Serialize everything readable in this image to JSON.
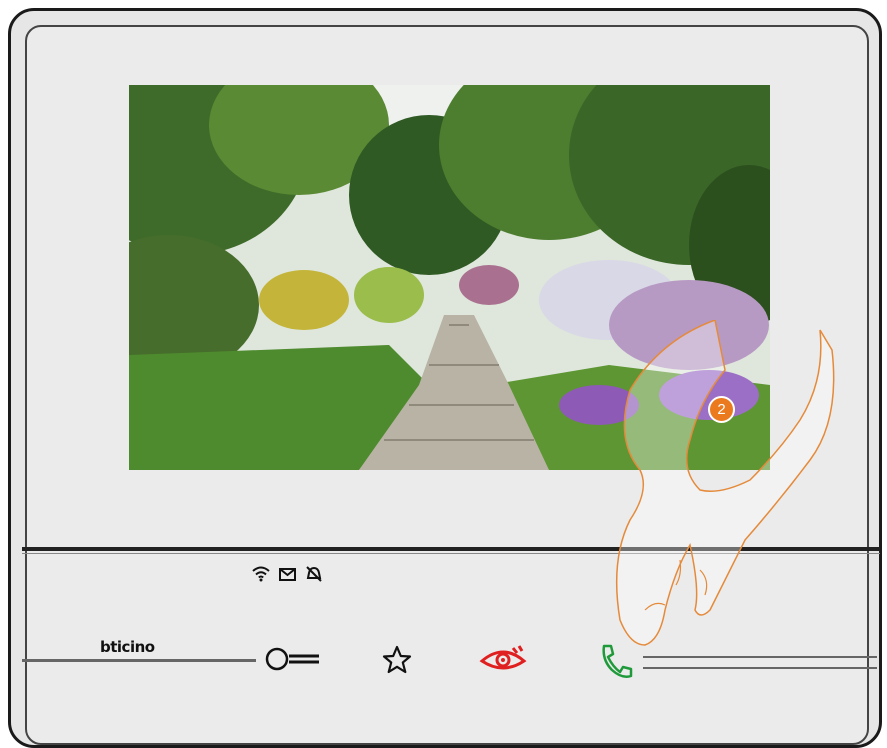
{
  "device": {
    "brand_logo": "bticino",
    "screen_image": "garden-path-camera-view"
  },
  "status_icons": [
    {
      "icon": "wifi-icon"
    },
    {
      "icon": "envelope-icon"
    },
    {
      "icon": "bell-muted-icon"
    }
  ],
  "buttons": {
    "door_lock": {
      "icon": "key-icon"
    },
    "favorites": {
      "icon": "star-icon"
    },
    "camera_view": {
      "icon": "eye-icon",
      "color": "#e02020"
    },
    "answer_call": {
      "icon": "phone-icon",
      "color": "#1f9a3a"
    }
  },
  "annotation": {
    "step_number": "2",
    "color": "#ea7a1d"
  }
}
